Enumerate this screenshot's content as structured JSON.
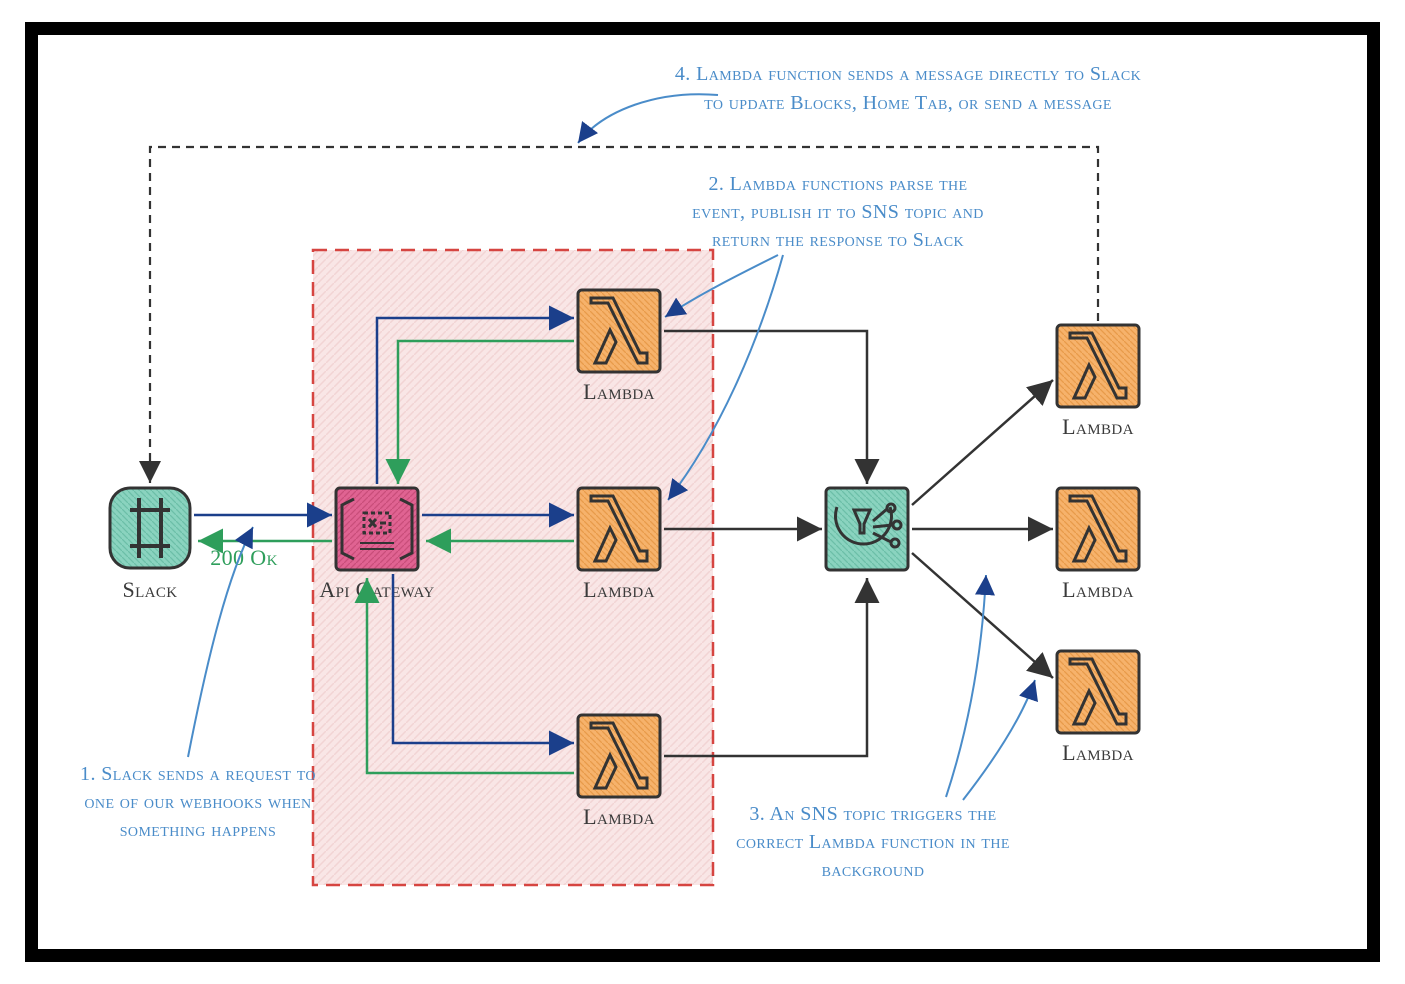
{
  "nodes": {
    "slack_label": "Slack",
    "apigw_label": "Api Gateway",
    "lambda1_label": "Lambda",
    "lambda2_label": "Lambda",
    "lambda3_label": "Lambda",
    "lambdaR1_label": "Lambda",
    "lambdaR2_label": "Lambda",
    "lambdaR3_label": "Lambda"
  },
  "edges": {
    "ok_label": "200 Ok"
  },
  "annotations": {
    "step4_l1": "4. Lambda function sends a message directly to Slack",
    "step4_l2": "to update Blocks, Home Tab, or send a message",
    "step2_l1": "2. Lambda functions parse the",
    "step2_l2": "event, publish it to SNS topic and",
    "step2_l3": "return the response to Slack",
    "step1_l1": "1. Slack sends a request to",
    "step1_l2": "one of our webhooks when",
    "step1_l3": "something happens",
    "step3_l1": "3. An SNS topic triggers the",
    "step3_l2": "correct Lambda function in the",
    "step3_l3": "background"
  }
}
